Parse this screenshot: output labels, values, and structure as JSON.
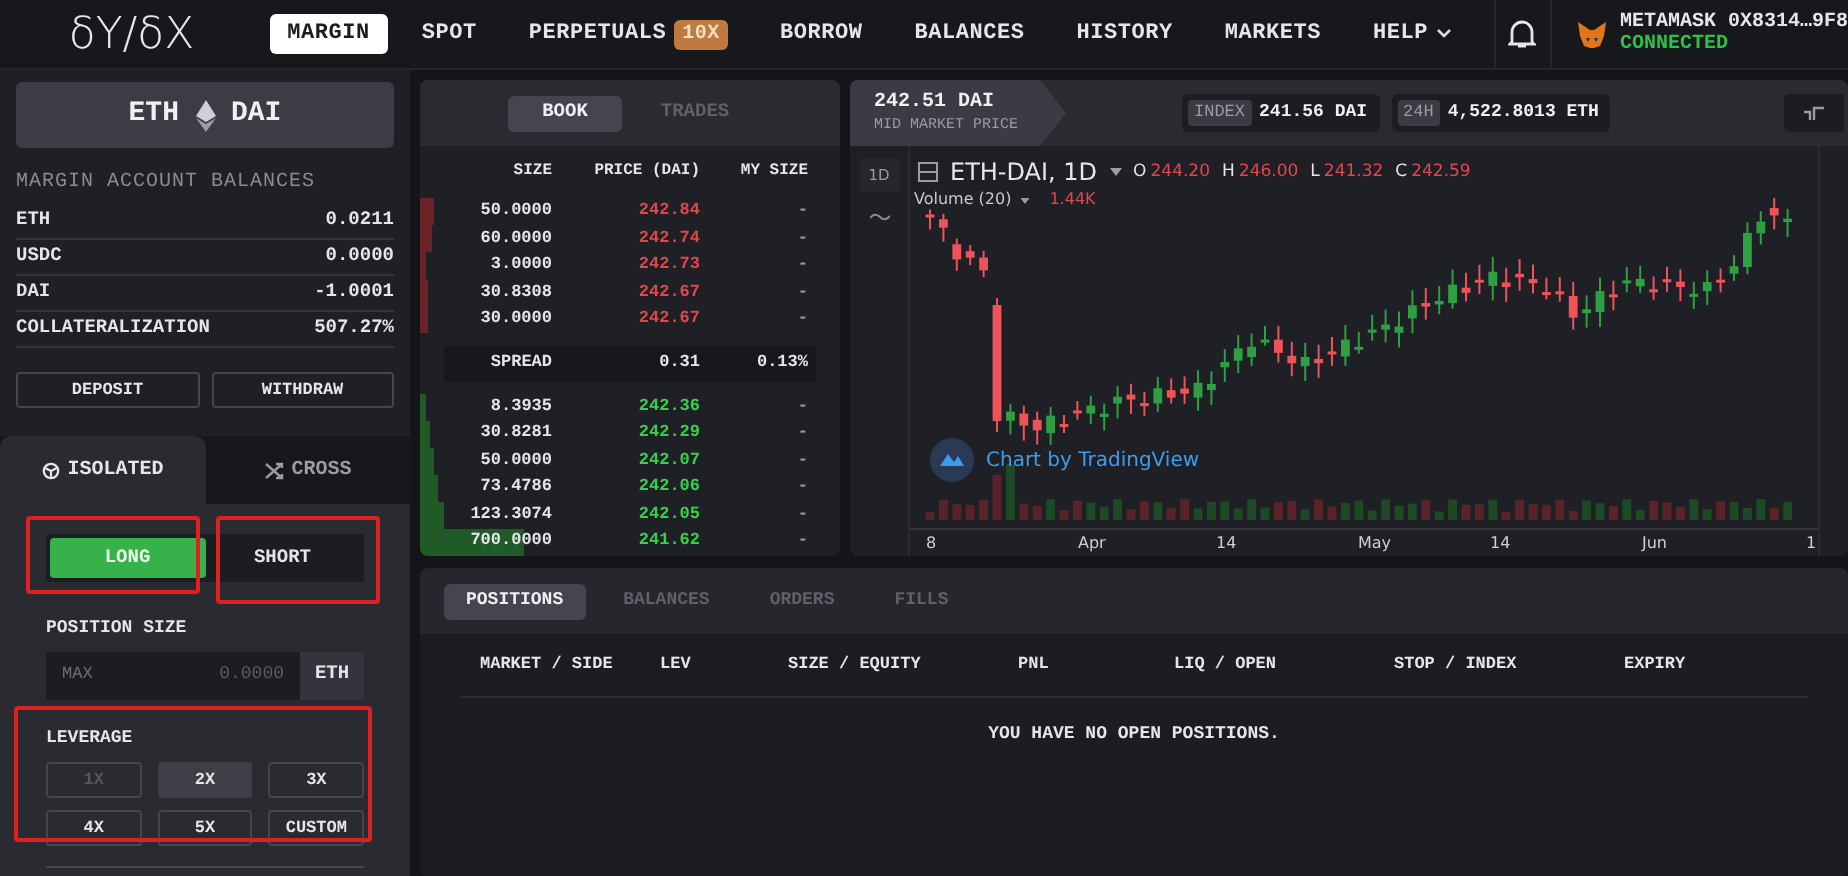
{
  "logo": "δY/δX",
  "nav": {
    "items": [
      {
        "label": "MARGIN",
        "selected": true
      },
      {
        "label": "SPOT",
        "selected": false
      },
      {
        "label": "PERPETUALS",
        "selected": false,
        "badge": "10X"
      },
      {
        "label": "BORROW",
        "selected": false
      },
      {
        "label": "BALANCES",
        "selected": false
      },
      {
        "label": "HISTORY",
        "selected": false
      },
      {
        "label": "MARKETS",
        "selected": false
      },
      {
        "label": "HELP",
        "selected": false,
        "dropdown": true
      }
    ],
    "wallet": {
      "name": "METAMASK 0X8314…9F8",
      "status": "CONNECTED"
    }
  },
  "sidebar": {
    "pair": {
      "base": "ETH",
      "quote": "DAI"
    },
    "balances_title": "MARGIN ACCOUNT BALANCES",
    "balances": [
      {
        "label": "ETH",
        "value": "0.0211"
      },
      {
        "label": "USDC",
        "value": "0.0000"
      },
      {
        "label": "DAI",
        "value": "-1.0001"
      },
      {
        "label": "COLLATERALIZATION",
        "value": "507.27%"
      }
    ],
    "buttons": [
      "DEPOSIT",
      "WITHDRAW"
    ],
    "mode_tabs": [
      {
        "label": "ISOLATED",
        "selected": true,
        "kind": "isolated"
      },
      {
        "label": "CROSS",
        "selected": false,
        "kind": "cross"
      }
    ],
    "sides": [
      {
        "label": "LONG",
        "selected": true
      },
      {
        "label": "SHORT",
        "selected": false
      }
    ],
    "position_size": {
      "label": "POSITION SIZE",
      "prefix": "MAX",
      "placeholder": "0.0000",
      "unit": "ETH"
    },
    "leverage": {
      "label": "LEVERAGE",
      "options": [
        {
          "label": "1X",
          "selected": false,
          "disabled": true
        },
        {
          "label": "2X",
          "selected": true,
          "disabled": false
        },
        {
          "label": "3X",
          "selected": false,
          "disabled": false
        },
        {
          "label": "4X",
          "selected": false,
          "disabled": false
        },
        {
          "label": "5X",
          "selected": false,
          "disabled": false
        },
        {
          "label": "CUSTOM",
          "selected": false,
          "disabled": false
        }
      ]
    }
  },
  "order_book": {
    "tabs": [
      {
        "label": "BOOK",
        "selected": true
      },
      {
        "label": "TRADES",
        "selected": false
      }
    ],
    "columns": [
      "SIZE",
      "PRICE (DAI)",
      "MY SIZE"
    ],
    "asks": [
      {
        "size": "50.0000",
        "price": "242.84",
        "my_size": "-"
      },
      {
        "size": "60.0000",
        "price": "242.74",
        "my_size": "-"
      },
      {
        "size": "3.0000",
        "price": "242.73",
        "my_size": "-"
      },
      {
        "size": "30.8308",
        "price": "242.67",
        "my_size": "-"
      },
      {
        "size": "30.0000",
        "price": "242.67",
        "my_size": "-"
      }
    ],
    "spread": {
      "label": "SPREAD",
      "value": "0.31",
      "percent": "0.13%"
    },
    "bids": [
      {
        "size": "8.3935",
        "price": "242.36",
        "my_size": "-"
      },
      {
        "size": "30.8281",
        "price": "242.29",
        "my_size": "-"
      },
      {
        "size": "50.0000",
        "price": "242.07",
        "my_size": "-"
      },
      {
        "size": "73.4786",
        "price": "242.06",
        "my_size": "-"
      },
      {
        "size": "123.3074",
        "price": "242.05",
        "my_size": "-"
      },
      {
        "size": "700.0000",
        "price": "241.62",
        "my_size": "-"
      }
    ]
  },
  "market": {
    "mid_price": "242.51 DAI",
    "mid_label": "MID MARKET PRICE",
    "index_label": "INDEX",
    "index_value": "241.56 DAI",
    "volume_label": "24H",
    "volume_value": "4,522.8013 ETH"
  },
  "chart": {
    "interval_button": "1D",
    "symbol": "ETH-DAI, 1D",
    "ohlc": [
      {
        "key": "O",
        "value": "244.20"
      },
      {
        "key": "H",
        "value": "246.00"
      },
      {
        "key": "L",
        "value": "241.32"
      },
      {
        "key": "C",
        "value": "242.59"
      }
    ],
    "volume_label": "Volume (20)",
    "volume_value": "1.44K",
    "attribution": "Chart by TradingView",
    "x_labels": [
      "8",
      "Apr",
      "14",
      "May",
      "14",
      "Jun",
      "1"
    ]
  },
  "positions": {
    "tabs": [
      {
        "label": "POSITIONS",
        "selected": true
      },
      {
        "label": "BALANCES",
        "selected": false
      },
      {
        "label": "ORDERS",
        "selected": false
      },
      {
        "label": "FILLS",
        "selected": false
      }
    ],
    "columns": [
      "MARKET / SIDE",
      "LEV",
      "SIZE / EQUITY",
      "PNL",
      "LIQ / OPEN",
      "STOP / INDEX",
      "EXPIRY"
    ],
    "empty_message": "YOU HAVE NO OPEN POSITIONS."
  }
}
